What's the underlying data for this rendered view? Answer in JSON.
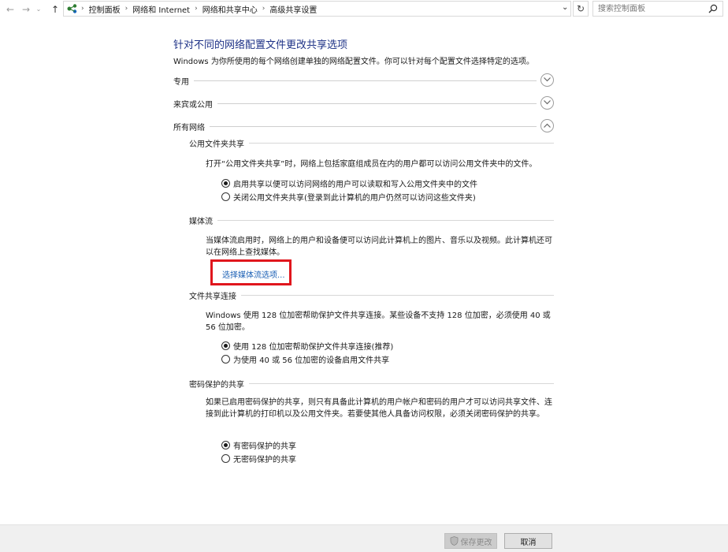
{
  "nav": {
    "crumbs": [
      "控制面板",
      "网络和 Internet",
      "网络和共享中心",
      "高级共享设置"
    ],
    "search_placeholder": "搜索控制面板"
  },
  "header": {
    "title": "针对不同的网络配置文件更改共享选项",
    "description": "Windows 为你所使用的每个网络创建单独的网络配置文件。你可以针对每个配置文件选择特定的选项。"
  },
  "sections": {
    "private": "专用",
    "guest": "来宾或公用",
    "all": "所有网络"
  },
  "public_folder": {
    "heading": "公用文件夹共享",
    "text": "打开“公用文件夹共享”时，网络上包括家庭组成员在内的用户都可以访问公用文件夹中的文件。",
    "options": [
      "启用共享以便可以访问网络的用户可以读取和写入公用文件夹中的文件",
      "关闭公用文件夹共享(登录到此计算机的用户仍然可以访问这些文件夹)"
    ],
    "selected_index": 0
  },
  "media": {
    "heading": "媒体流",
    "text": "当媒体流启用时，网络上的用户和设备便可以访问此计算机上的图片、音乐以及视频。此计算机还可以在网络上查找媒体。",
    "link": "选择媒体流选项..."
  },
  "file_sharing": {
    "heading": "文件共享连接",
    "text": "Windows 使用 128 位加密帮助保护文件共享连接。某些设备不支持 128 位加密，必须使用 40 或 56 位加密。",
    "options": [
      "使用 128 位加密帮助保护文件共享连接(推荐)",
      "为使用 40 或 56 位加密的设备启用文件共享"
    ],
    "selected_index": 0
  },
  "password": {
    "heading": "密码保护的共享",
    "text": "如果已启用密码保护的共享，则只有具备此计算机的用户帐户和密码的用户才可以访问共享文件、连接到此计算机的打印机以及公用文件夹。若要使其他人具备访问权限，必须关闭密码保护的共享。",
    "options": [
      "有密码保护的共享",
      "无密码保护的共享"
    ],
    "selected_index": 0
  },
  "footer": {
    "save_label": "保存更改",
    "cancel_label": "取消"
  },
  "colors": {
    "title": "#1e3287",
    "link": "#1a5fb4",
    "highlight_border": "#e0161d"
  }
}
